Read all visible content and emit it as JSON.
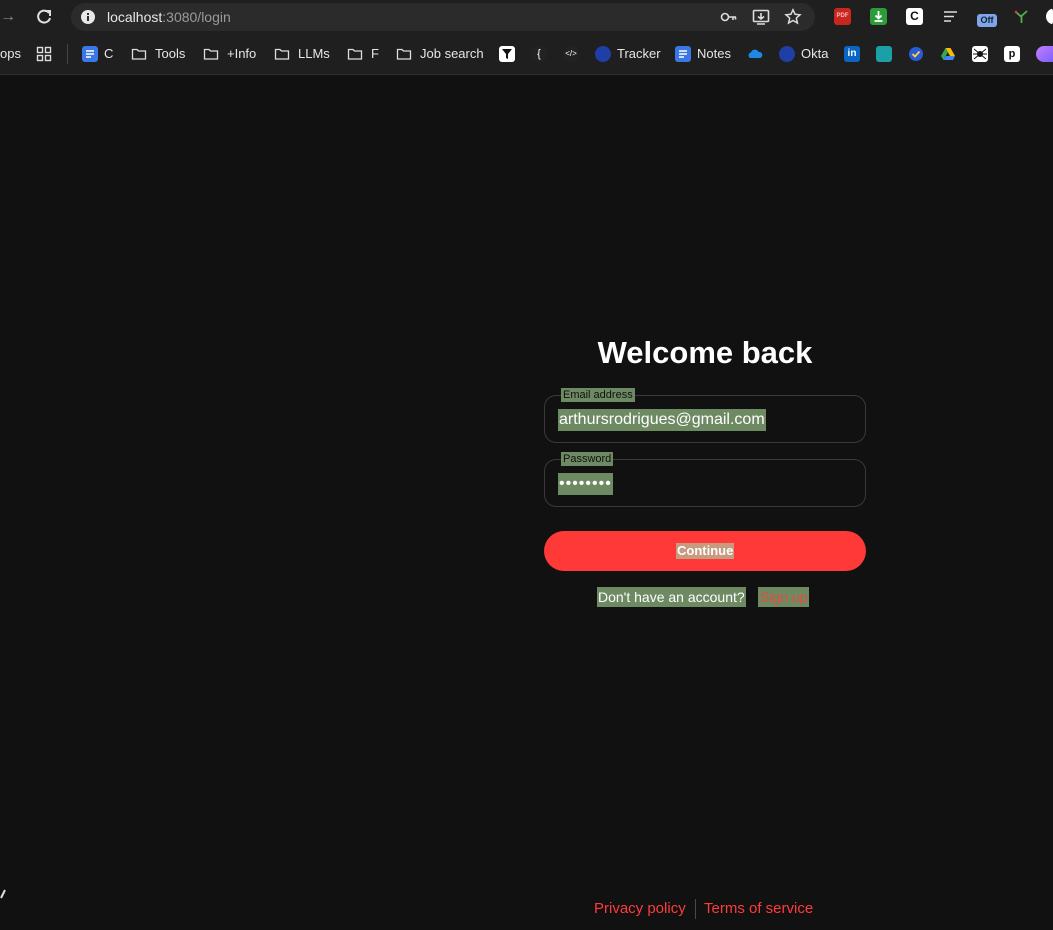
{
  "browser": {
    "url_host": "localhost",
    "url_path": ":3080/login",
    "bookmarks_cut": "ops",
    "bookmarks": {
      "c": "C",
      "tools": "Tools",
      "info": "+Info",
      "llms": "LLMs",
      "f": "F",
      "job_search": "Job search",
      "tracker": "Tracker",
      "notes": "Notes",
      "okta": "Okta"
    },
    "extensions": {
      "pdf": "PDF",
      "c": "C",
      "off": "Off",
      "p": "p",
      "linkedin": "in"
    }
  },
  "login": {
    "title": "Welcome back",
    "email_label": "Email address",
    "email_value": "arthursrodrigues@gmail.com",
    "password_label": "Password",
    "password_value": "••••••••",
    "continue_label": "Continue",
    "no_account": "Don't have an account?",
    "sign_up": "Sign up"
  },
  "footer": {
    "privacy": "Privacy policy",
    "terms": "Terms of service"
  },
  "colors": {
    "background": "#111111",
    "accent": "#ff3838",
    "link": "#ff3b3b",
    "autofill_highlight": "#6d8a63"
  }
}
